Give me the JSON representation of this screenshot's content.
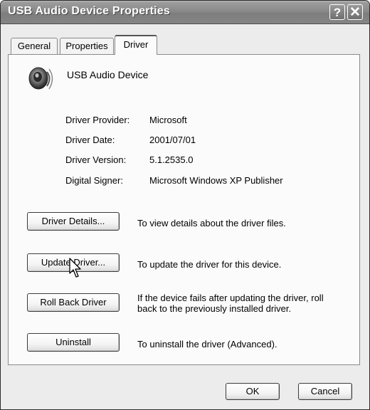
{
  "window": {
    "title": "USB Audio Device Properties",
    "help_glyph": "?",
    "close_glyph": "✕"
  },
  "tabs": [
    {
      "label": "General",
      "active": false
    },
    {
      "label": "Properties",
      "active": false
    },
    {
      "label": "Driver",
      "active": true
    }
  ],
  "device": {
    "name": "USB Audio Device",
    "icon": "speaker-icon"
  },
  "driver_info": [
    {
      "label": "Driver Provider:",
      "value": "Microsoft"
    },
    {
      "label": "Driver Date:",
      "value": "2001/07/01"
    },
    {
      "label": "Driver Version:",
      "value": "5.1.2535.0"
    },
    {
      "label": "Digital Signer:",
      "value": "Microsoft Windows XP Publisher"
    }
  ],
  "actions": [
    {
      "label": "Driver Details...",
      "description": "To view details about the driver files."
    },
    {
      "label": "Update Driver...",
      "description": "To update the driver for this device."
    },
    {
      "label": "Roll Back Driver",
      "description": "If the device fails after updating the driver, roll back to the previously installed driver."
    },
    {
      "label": "Uninstall",
      "description": "To uninstall the driver (Advanced)."
    }
  ],
  "dialog_buttons": {
    "ok": "OK",
    "cancel": "Cancel"
  },
  "colors": {
    "titlebar": "#8a8a8a",
    "panel": "#fbfbfb",
    "window": "#ececec"
  }
}
